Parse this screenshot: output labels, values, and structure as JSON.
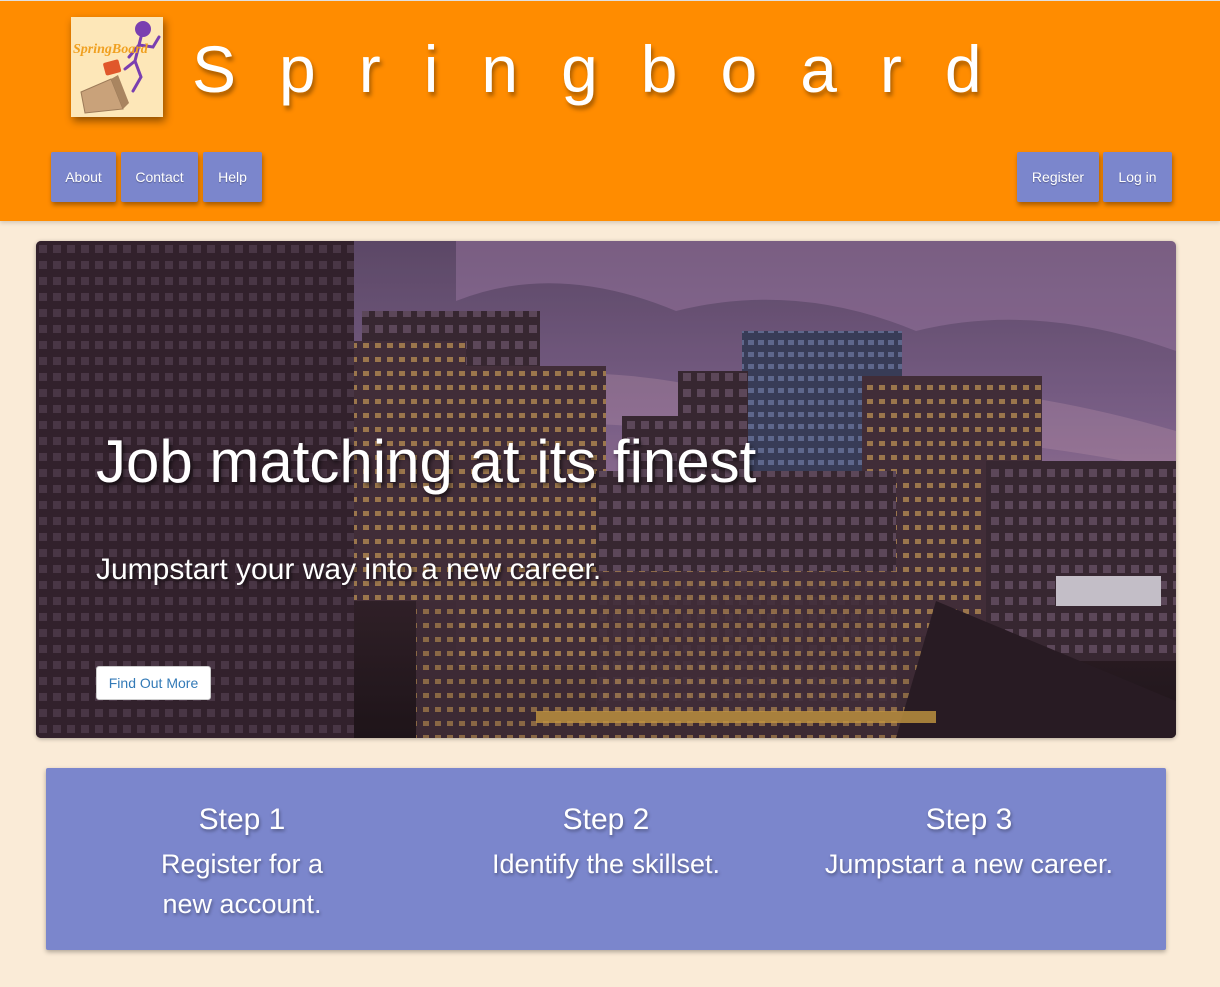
{
  "header": {
    "brand": "Springboard",
    "logo_text": "SpringBoard",
    "nav_left": [
      "About",
      "Contact",
      "Help"
    ],
    "nav_right": [
      "Register",
      "Log in"
    ],
    "colors": {
      "header_bg": "#ff8c00",
      "button_bg": "#7b86cc",
      "page_bg": "#faebd7"
    }
  },
  "hero": {
    "title": "Job matching at its finest",
    "subtitle": "Jumpstart your way into a new career.",
    "cta": "Find Out More"
  },
  "steps": [
    {
      "title": "Step 1",
      "text": "Register for a new account."
    },
    {
      "title": "Step 2",
      "text": "Identify the skillset."
    },
    {
      "title": "Step 3",
      "text": "Jumpstart a new career."
    }
  ]
}
